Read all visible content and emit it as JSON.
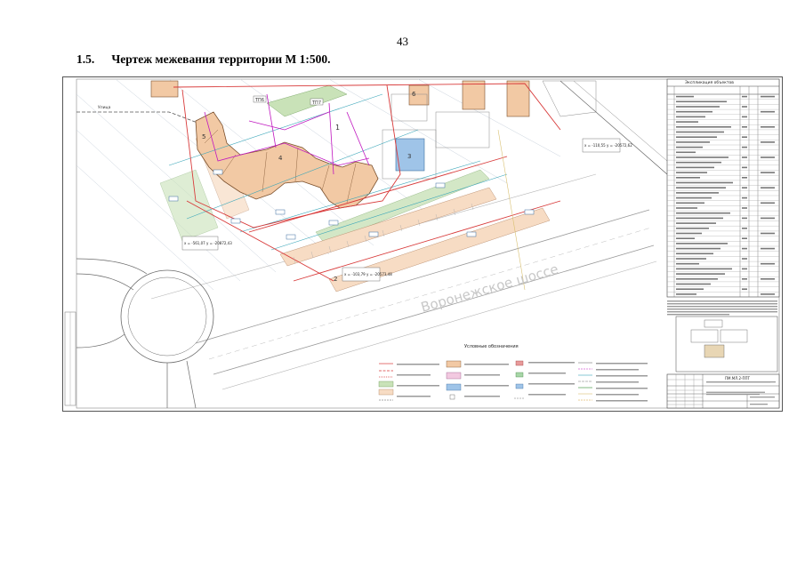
{
  "page": {
    "number": "43",
    "section": {
      "number": "1.5.",
      "title": "Чертеж межевания территории М 1:500."
    }
  },
  "drawing": {
    "road_label": "Воронежское шоссе",
    "zone_labels": [
      "ТП6",
      "ТП7",
      "1",
      "2",
      "3",
      "4",
      "5",
      "6"
    ],
    "coord_labels": [
      "x = -561,07  y = -20872,43",
      "x = -110,55  y = -20572,62",
      "x = -103,79  y = -20573,48"
    ],
    "table_title": "Экспликация объектов",
    "legend_title": "Условные обозначения",
    "stamp_code": "ПМ.МЛ.2-ППТ",
    "colors": {
      "building_fill": "#f2c9a4",
      "building_stroke": "#7a4f2c",
      "boundary_red": "#d83a3a",
      "utility_magenta": "#c018c0",
      "green_area": "#c9e2b8",
      "blue_area": "#9fc4e8",
      "road_edge": "#7b7b7b",
      "cyan_lines": "#3aa6b9"
    }
  }
}
